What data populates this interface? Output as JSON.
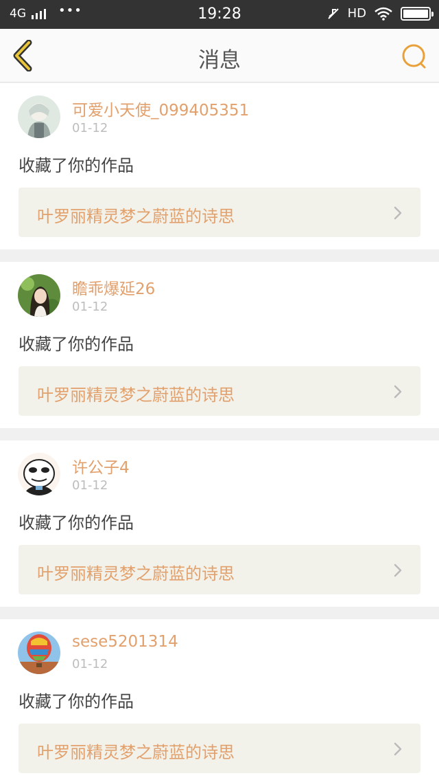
{
  "status_bar": {
    "network": "4G",
    "time": "19:28",
    "hd": "HD"
  },
  "nav": {
    "title": "消息",
    "back_icon": "chevron-left-icon",
    "search_icon": "search-icon",
    "accent_color": "#e8a13a"
  },
  "messages": [
    {
      "username": "可爱小天使_099405351",
      "date": "01-12",
      "action": "收藏了你的作品",
      "work_title": "叶罗丽精灵梦之蔚蓝的诗思"
    },
    {
      "username": "瞻乖爆延26",
      "date": "01-12",
      "action": "收藏了你的作品",
      "work_title": "叶罗丽精灵梦之蔚蓝的诗思"
    },
    {
      "username": "许公子4",
      "date": "01-12",
      "action": "收藏了你的作品",
      "work_title": "叶罗丽精灵梦之蔚蓝的诗思"
    },
    {
      "username": "sese5201314",
      "date": "01-12",
      "action": "收藏了你的作品",
      "work_title": "叶罗丽精灵梦之蔚蓝的诗思"
    }
  ],
  "colors": {
    "username": "#e2a06c",
    "date": "#bdbdbd",
    "card_link_bg": "#f3f2ea"
  }
}
